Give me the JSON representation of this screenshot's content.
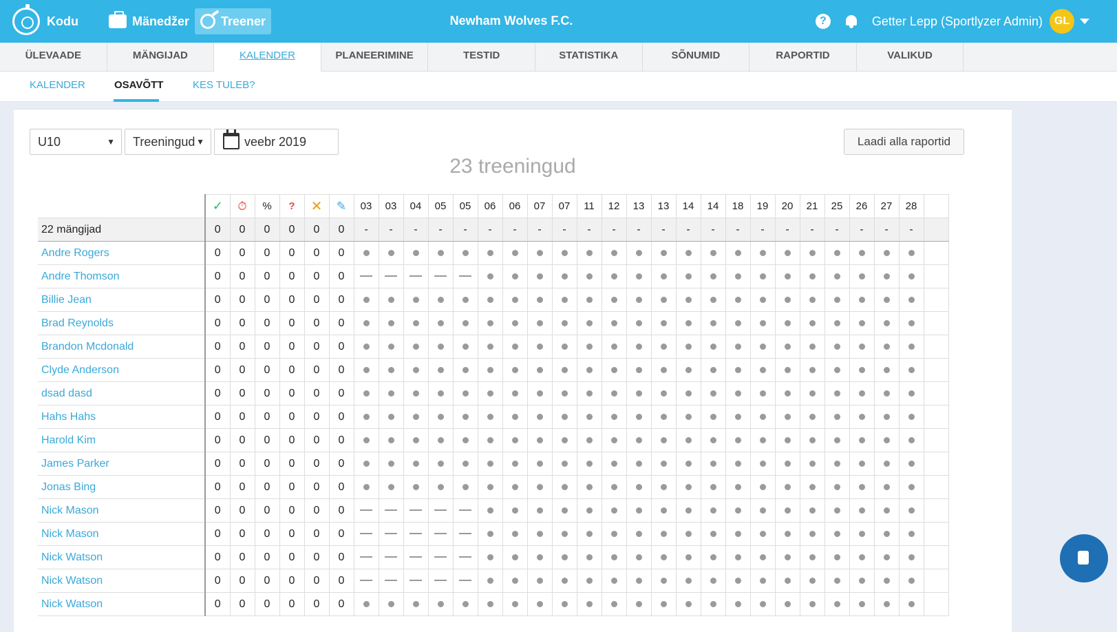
{
  "topbar": {
    "brand_label": "Kodu",
    "nav": [
      {
        "label": "Mänedžer",
        "icon": "briefcase-icon"
      },
      {
        "label": "Treener",
        "icon": "whistle-icon"
      }
    ],
    "team_name": "Newham Wolves F.C.",
    "user_name": "Getter Lepp (Sportlyzer Admin)",
    "user_initials": "GL",
    "help_label": "?"
  },
  "main_tabs": [
    "ÜLEVAADE",
    "MÄNGIJAD",
    "KALENDER",
    "PLANEERIMINE",
    "TESTID",
    "STATISTIKA",
    "SÕNUMID",
    "RAPORTID",
    "VALIKUD"
  ],
  "sub_tabs": [
    "KALENDER",
    "OSAVÕTT",
    "KES TULEB?"
  ],
  "filters": {
    "group": "U10",
    "type": "Treeningud",
    "month": "veebr 2019",
    "download_label": "Laadi alla raportid"
  },
  "summary_title": "23 treeningud",
  "table": {
    "stat_headers": [
      "✓",
      "⏱",
      "%",
      "?",
      "✕",
      "✎"
    ],
    "stat_icons": [
      "check-icon",
      "timer-icon",
      "percent-icon",
      "question-icon",
      "cross-icon",
      "pencil-icon"
    ],
    "days": [
      "03",
      "03",
      "04",
      "05",
      "05",
      "06",
      "06",
      "07",
      "07",
      "11",
      "12",
      "13",
      "13",
      "14",
      "14",
      "18",
      "19",
      "20",
      "21",
      "25",
      "26",
      "27",
      "28"
    ],
    "summary_label": "22 mängijad",
    "summary_stats": [
      "0",
      "0",
      "0",
      "0",
      "0",
      "0"
    ],
    "summary_mark": "-",
    "rows": [
      {
        "name": "Andre Rogers",
        "stats": [
          "0",
          "0",
          "0",
          "0",
          "0",
          "0"
        ],
        "dashes": 0
      },
      {
        "name": "Andre Thomson",
        "stats": [
          "0",
          "0",
          "0",
          "0",
          "0",
          "0"
        ],
        "dashes": 5
      },
      {
        "name": "Billie Jean",
        "stats": [
          "0",
          "0",
          "0",
          "0",
          "0",
          "0"
        ],
        "dashes": 0
      },
      {
        "name": "Brad Reynolds",
        "stats": [
          "0",
          "0",
          "0",
          "0",
          "0",
          "0"
        ],
        "dashes": 0
      },
      {
        "name": "Brandon Mcdonald",
        "stats": [
          "0",
          "0",
          "0",
          "0",
          "0",
          "0"
        ],
        "dashes": 0
      },
      {
        "name": "Clyde Anderson",
        "stats": [
          "0",
          "0",
          "0",
          "0",
          "0",
          "0"
        ],
        "dashes": 0
      },
      {
        "name": "dsad dasd",
        "stats": [
          "0",
          "0",
          "0",
          "0",
          "0",
          "0"
        ],
        "dashes": 0
      },
      {
        "name": "Hahs Hahs",
        "stats": [
          "0",
          "0",
          "0",
          "0",
          "0",
          "0"
        ],
        "dashes": 0
      },
      {
        "name": "Harold Kim",
        "stats": [
          "0",
          "0",
          "0",
          "0",
          "0",
          "0"
        ],
        "dashes": 0
      },
      {
        "name": "James Parker",
        "stats": [
          "0",
          "0",
          "0",
          "0",
          "0",
          "0"
        ],
        "dashes": 0
      },
      {
        "name": "Jonas Bing",
        "stats": [
          "0",
          "0",
          "0",
          "0",
          "0",
          "0"
        ],
        "dashes": 0
      },
      {
        "name": "Nick Mason",
        "stats": [
          "0",
          "0",
          "0",
          "0",
          "0",
          "0"
        ],
        "dashes": 5
      },
      {
        "name": "Nick Mason",
        "stats": [
          "0",
          "0",
          "0",
          "0",
          "0",
          "0"
        ],
        "dashes": 5
      },
      {
        "name": "Nick Watson",
        "stats": [
          "0",
          "0",
          "0",
          "0",
          "0",
          "0"
        ],
        "dashes": 5
      },
      {
        "name": "Nick Watson",
        "stats": [
          "0",
          "0",
          "0",
          "0",
          "0",
          "0"
        ],
        "dashes": 5
      },
      {
        "name": "Nick Watson",
        "stats": [
          "0",
          "0",
          "0",
          "0",
          "0",
          "0"
        ],
        "dashes": 0
      }
    ]
  },
  "colors": {
    "primary": "#33b5e5",
    "link": "#3aa9d8",
    "avatar": "#f5c518"
  }
}
